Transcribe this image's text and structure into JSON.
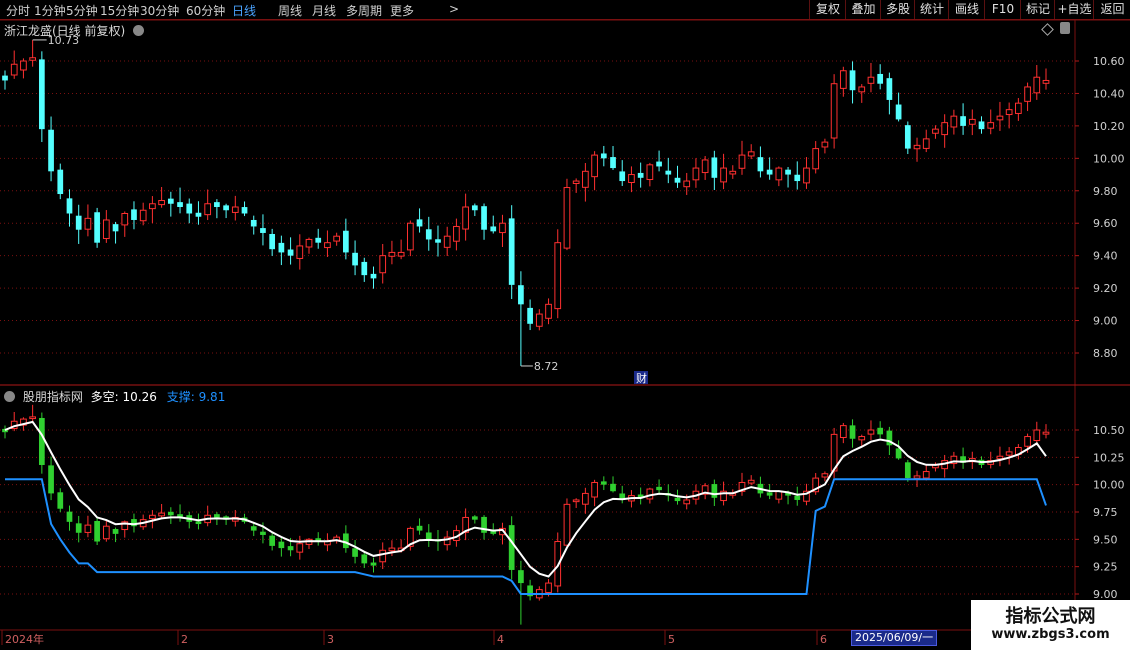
{
  "toolbar": {
    "periods": [
      "分时",
      "1分钟",
      "5分钟",
      "15分钟",
      "30分钟",
      "60分钟",
      "日线",
      "周线",
      "月线",
      "多周期",
      "更多"
    ],
    "active_period": "日线",
    "more_arrow": ">",
    "right_buttons": [
      "复权",
      "叠加",
      "多股",
      "统计",
      "画线",
      "F10",
      "标记",
      "+自选",
      "返回"
    ]
  },
  "main_chart": {
    "title": "浙江龙盛(日线 前复权)",
    "price_labels": [
      "10.60",
      "10.40",
      "10.20",
      "10.00",
      "9.80",
      "9.60",
      "9.40",
      "9.20",
      "9.00",
      "8.80"
    ],
    "high_marker": "10.73",
    "low_marker": "8.72",
    "finance_badge": "财"
  },
  "indicator": {
    "name": "股朋指标网",
    "duokong_label": "多空:",
    "duokong_value": "10.26",
    "support_label": "支撑:",
    "support_value": "9.81",
    "axis_labels": [
      "10.50",
      "10.25",
      "10.00",
      "9.75",
      "9.50",
      "9.25",
      "9.00"
    ]
  },
  "date_axis": {
    "labels": [
      "2024年",
      "2",
      "3",
      "4",
      "5",
      "6"
    ],
    "cursor_date": "2025/06/09/一"
  },
  "watermark": {
    "line1": "指标公式网",
    "line2": "www.zbgs3.com"
  },
  "colors": {
    "up": "#ff3030",
    "down_main": "#54ffff",
    "down_ind": "#30d030",
    "support": "#1e90ff",
    "duokong": "#ffffff",
    "grid": "#7a1010"
  },
  "chart_data": {
    "type": "candlestick",
    "price_axis": {
      "min": 8.72,
      "max": 10.73
    },
    "indicator_axis": {
      "min": 9.0,
      "max": 10.5
    },
    "closes": [
      10.48,
      10.58,
      10.6,
      10.62,
      10.18,
      9.92,
      9.78,
      9.66,
      9.56,
      9.63,
      9.48,
      9.62,
      9.55,
      9.66,
      9.62,
      9.68,
      9.72,
      9.74,
      9.72,
      9.7,
      9.66,
      9.64,
      9.72,
      9.7,
      9.68,
      9.7,
      9.66,
      9.58,
      9.54,
      9.44,
      9.42,
      9.4,
      9.46,
      9.5,
      9.48,
      9.48,
      9.52,
      9.42,
      9.34,
      9.28,
      9.26,
      9.4,
      9.42,
      9.42,
      9.6,
      9.58,
      9.5,
      9.48,
      9.52,
      9.58,
      9.7,
      9.68,
      9.56,
      9.55,
      9.6,
      9.22,
      9.1,
      8.98,
      9.04,
      9.1,
      9.48,
      9.82,
      9.86,
      9.92,
      10.02,
      10.0,
      9.94,
      9.86,
      9.9,
      9.88,
      9.96,
      9.95,
      9.9,
      9.85,
      9.86,
      9.94,
      9.99,
      9.88,
      9.94,
      9.92,
      10.02,
      10.04,
      9.92,
      9.9,
      9.94,
      9.9,
      9.86,
      9.94,
      10.06,
      10.1,
      10.46,
      10.54,
      10.42,
      10.44,
      10.5,
      10.46,
      10.36,
      10.24,
      10.06,
      10.08,
      10.12,
      10.18,
      10.22,
      10.26,
      10.2,
      10.24,
      10.18,
      10.22,
      10.26,
      10.3,
      10.34,
      10.44,
      10.5,
      10.48
    ],
    "duokong_line": {
      "start": 10.5,
      "end": 10.26
    },
    "support_line": {
      "start": 10.05,
      "end": 9.81
    }
  }
}
